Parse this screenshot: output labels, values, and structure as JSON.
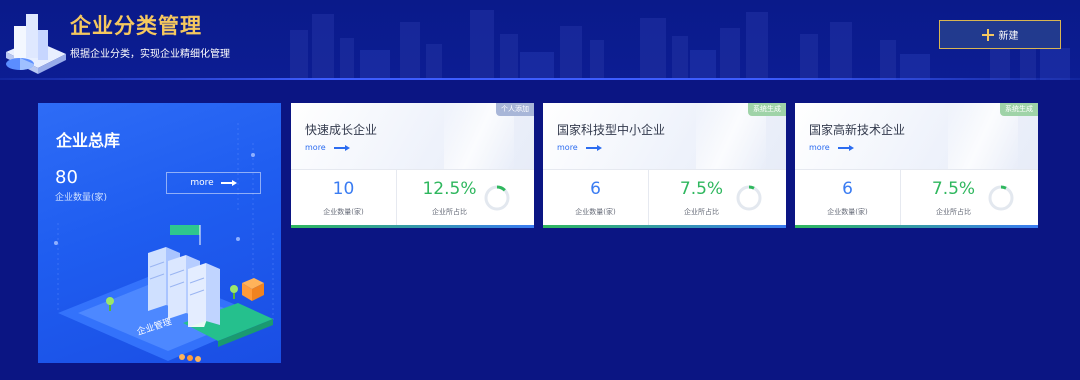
{
  "header": {
    "title": "企业分类管理",
    "subtitle": "根据企业分类，实现企业精细化管理",
    "new_button_label": "新建",
    "accent_color": "#f6c85f"
  },
  "total_card": {
    "title": "企业总库",
    "count": "80",
    "count_label": "企业数量(家)",
    "more_label": "more",
    "illustration_label": "企业管理"
  },
  "categories": [
    {
      "name": "快速成长企业",
      "tag": "个人添加",
      "tag_color": "#a8b6d8",
      "more_label": "more",
      "count": "10",
      "count_label": "企业数量(家)",
      "percent": "12.5%",
      "percent_value": 0.125,
      "percent_label": "企业所占比"
    },
    {
      "name": "国家科技型中小企业",
      "tag": "系统生成",
      "tag_color": "#9fd3a8",
      "more_label": "more",
      "count": "6",
      "count_label": "企业数量(家)",
      "percent": "7.5%",
      "percent_value": 0.075,
      "percent_label": "企业所占比"
    },
    {
      "name": "国家高新技术企业",
      "tag": "系统生成",
      "tag_color": "#9fd3a8",
      "more_label": "more",
      "count": "6",
      "count_label": "企业数量(家)",
      "percent": "7.5%",
      "percent_value": 0.075,
      "percent_label": "企业所占比"
    }
  ],
  "colors": {
    "background": "#0b1583",
    "count_blue": "#3a7cf2",
    "percent_green": "#2fb75e"
  }
}
